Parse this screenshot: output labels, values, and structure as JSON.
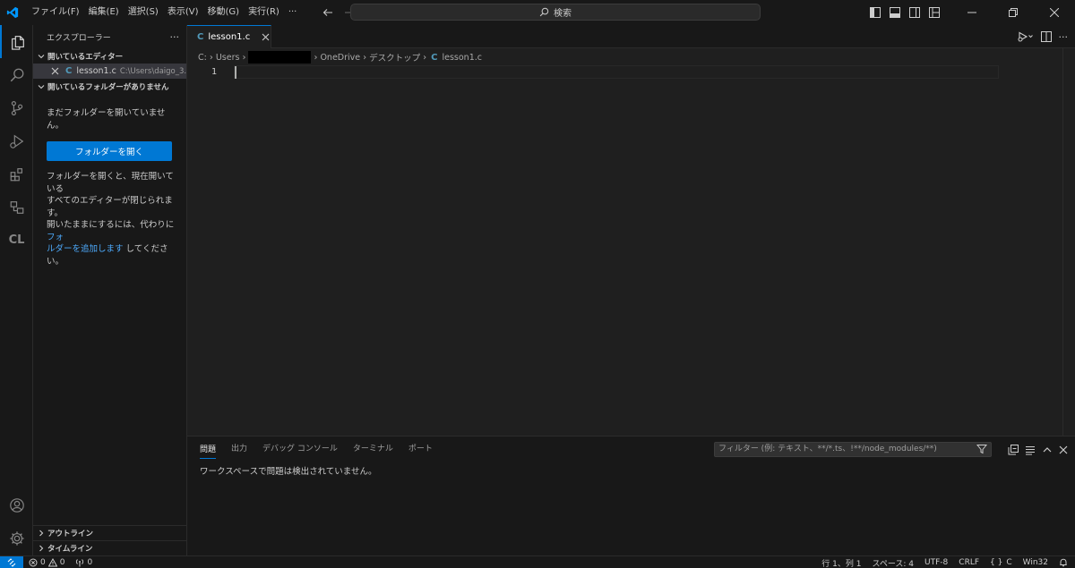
{
  "titlebar": {
    "menu": [
      "ファイル(F)",
      "編集(E)",
      "選択(S)",
      "表示(V)",
      "移動(G)",
      "実行(R)",
      "···"
    ],
    "search_label": "検索"
  },
  "sidebar": {
    "title": "エクスプローラー",
    "more": "···",
    "open_editors_header": "開いているエディター",
    "open_editor": {
      "name": "lesson1.c",
      "path": "C:\\Users\\daigo_3..."
    },
    "no_folder_header": "開いているフォルダーがありません",
    "no_folder_msg": "まだフォルダーを開いていません。",
    "open_folder_button": "フォルダーを開く",
    "desc_line1": "フォルダーを開くと、現在開いている",
    "desc_line2": "すべてのエディターが閉じられます。",
    "desc_line3": "開いたままにするには、代わりに",
    "desc_link1": "フォ",
    "desc_link2": "ルダーを追加します",
    "desc_tail": "してください。",
    "outline": "アウトライン",
    "timeline": "タイムライン"
  },
  "editor": {
    "tab_label": "lesson1.c",
    "breadcrumbs": {
      "drive": "C:",
      "users": "Users",
      "onedrive": "OneDrive",
      "desktop": "デスクトップ",
      "file": "lesson1.c"
    },
    "line_number": "1"
  },
  "panel": {
    "tabs": [
      "問題",
      "出力",
      "デバッグ コンソール",
      "ターミナル",
      "ポート"
    ],
    "filter_placeholder": "フィルター (例: テキスト、**/*.ts、!**/node_modules/**)",
    "message": "ワークスペースで問題は検出されていません。"
  },
  "statusbar": {
    "errors": "0",
    "warnings": "0",
    "ports": "0",
    "position": "行 1、列 1",
    "spaces": "スペース: 4",
    "encoding": "UTF-8",
    "eol": "CRLF",
    "language": "C",
    "platform": "Win32"
  },
  "colors": {
    "accent": "#0078d4",
    "c_icon": "#519aba",
    "link": "#4daafc"
  }
}
